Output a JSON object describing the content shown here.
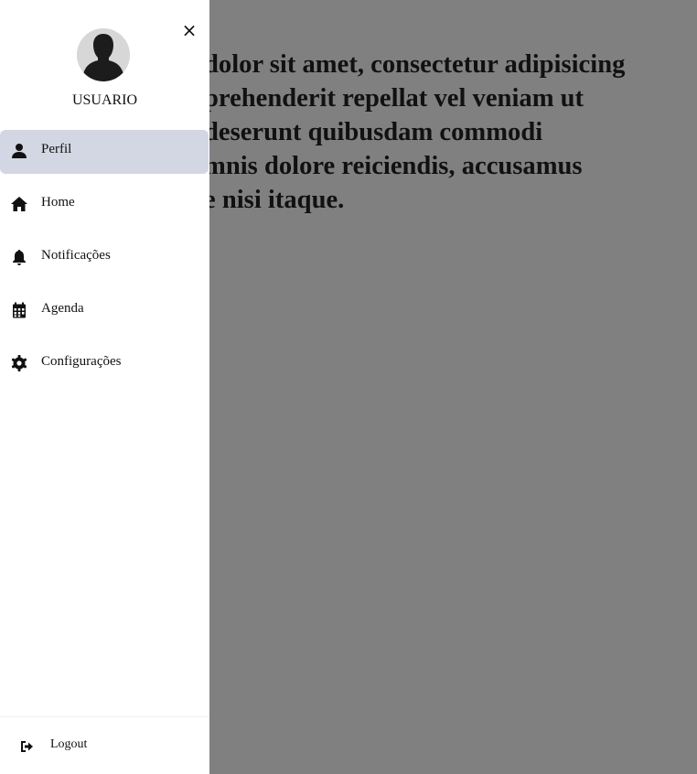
{
  "background_text": {
    "lines": [
      "dolor sit amet, consectetur adipisicing",
      "prehenderit repellat vel veniam ut",
      "deserunt quibusdam commodi",
      "mnis dolore reiciendis, accusamus",
      "e nisi itaque."
    ]
  },
  "drawer": {
    "close_icon": "×",
    "username": "USUARIO",
    "items": [
      {
        "label": "Perfil",
        "icon": "person-icon"
      },
      {
        "label": "Home",
        "icon": "home-icon"
      },
      {
        "label": "Notificações",
        "icon": "bell-icon"
      },
      {
        "label": "Agenda",
        "icon": "calendar-icon"
      },
      {
        "label": "Configurações",
        "icon": "gear-icon"
      }
    ],
    "logout_label": "Logout"
  },
  "colors": {
    "overlay": "#808080",
    "active_item": "#d3d7e3",
    "drawer_bg": "#ffffff"
  }
}
